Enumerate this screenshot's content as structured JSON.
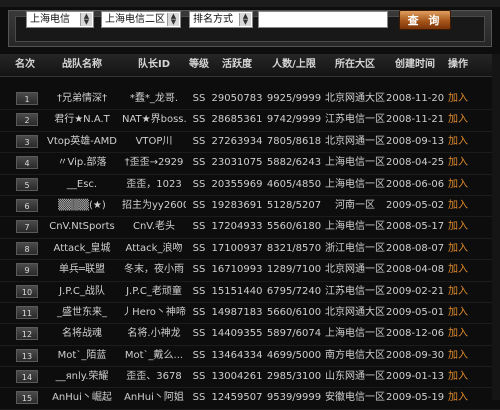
{
  "search": {
    "province": "上海电信",
    "region": "上海电信二区",
    "sort": "排名方式",
    "keyword": "",
    "button": "查 询"
  },
  "columns": [
    "名次",
    "战队名称",
    "队长ID",
    "等级",
    "活跃度",
    "人数/上限",
    "所在大区",
    "创建时间",
    "操作"
  ],
  "rows": [
    {
      "rank": "1",
      "name": "†兄弟情深†",
      "leader": "*蠢*_龙哥.",
      "level": "SS",
      "activity": "29050783",
      "members": "9925/9999",
      "area": "北京网通大区",
      "created": "2008-11-20",
      "op": "加入"
    },
    {
      "rank": "2",
      "name": "君行★N.A.T",
      "leader": "NAT★界boss.",
      "level": "SS",
      "activity": "28685361",
      "members": "9742/9999",
      "area": "江苏电信一区",
      "created": "2008-11-21",
      "op": "加入"
    },
    {
      "rank": "3",
      "name": "Vtop英雄-AMD",
      "leader": "VTOP川",
      "level": "SS",
      "activity": "27263934",
      "members": "7805/8618",
      "area": "北京网通一区",
      "created": "2008-09-13",
      "op": "加入"
    },
    {
      "rank": "4",
      "name": "〃Vip.部落",
      "leader": "†歪歪→2929",
      "level": "SS",
      "activity": "23031075",
      "members": "5882/6243",
      "area": "上海电信一区",
      "created": "2008-04-25",
      "op": "加入"
    },
    {
      "rank": "5",
      "name": "__Esc.",
      "leader": "歪歪，1023",
      "level": "SS",
      "activity": "20355969",
      "members": "4605/4850",
      "area": "上海电信一区",
      "created": "2008-06-06",
      "op": "加入"
    },
    {
      "rank": "6",
      "name": "▒▒▒▒(★)",
      "leader": "招主为yy2600",
      "level": "SS",
      "activity": "19283691",
      "members": "5128/5207",
      "area": "河南一区",
      "created": "2009-05-02",
      "op": "加入"
    },
    {
      "rank": "7",
      "name": "CnV.NtSports",
      "leader": "CnV.老头",
      "level": "SS",
      "activity": "17204933",
      "members": "5560/6180",
      "area": "上海电信一区",
      "created": "2008-05-17",
      "op": "加入"
    },
    {
      "rank": "8",
      "name": "Attack_皇城",
      "leader": "Attack_浪吻",
      "level": "SS",
      "activity": "17100937",
      "members": "8321/8570",
      "area": "浙江电信一区",
      "created": "2008-08-07",
      "op": "加入"
    },
    {
      "rank": "9",
      "name": "单兵═联盟",
      "leader": "冬末，夜小雨",
      "level": "SS",
      "activity": "16710993",
      "members": "1289/7100",
      "area": "北京网通一区",
      "created": "2008-04-08",
      "op": "加入"
    },
    {
      "rank": "10",
      "name": "J.P.C_战队",
      "leader": "J.P.C_老顽童",
      "level": "SS",
      "activity": "15151440",
      "members": "6795/7240",
      "area": "江苏电信一区",
      "created": "2009-02-21",
      "op": "加入"
    },
    {
      "rank": "11",
      "name": "_盛世东来_",
      "leader": "丿Hero丶神啼",
      "level": "SS",
      "activity": "14987183",
      "members": "5660/6100",
      "area": "北京网通大区",
      "created": "2009-05-01",
      "op": "加入"
    },
    {
      "rank": "12",
      "name": "名将战魂",
      "leader": "名将.小神龙",
      "level": "SS",
      "activity": "14409355",
      "members": "5897/6074",
      "area": "上海电信一区",
      "created": "2008-12-06",
      "op": "加入"
    },
    {
      "rank": "13",
      "name": "Mot`_陌蓝",
      "leader": "Mot`_戴么...",
      "level": "SS",
      "activity": "13464334",
      "members": "4699/5000",
      "area": "南方电信大区",
      "created": "2008-09-30",
      "op": "加入"
    },
    {
      "rank": "14",
      "name": "__яnly.荣耀",
      "leader": "歪歪、3678",
      "level": "SS",
      "activity": "13004261",
      "members": "2985/3100",
      "area": "山东网通一区",
      "created": "2009-01-13",
      "op": "加入"
    },
    {
      "rank": "15",
      "name": "AnHui丶崛起",
      "leader": "AnHui丶阿姐",
      "level": "SS",
      "activity": "12459507",
      "members": "9539/9999",
      "area": "安徽电信一区",
      "created": "2009-05-19",
      "op": "加入"
    }
  ],
  "colors": {
    "accent": "#e08a2c",
    "button": "#a8561a",
    "background": "#0d0d0d"
  }
}
